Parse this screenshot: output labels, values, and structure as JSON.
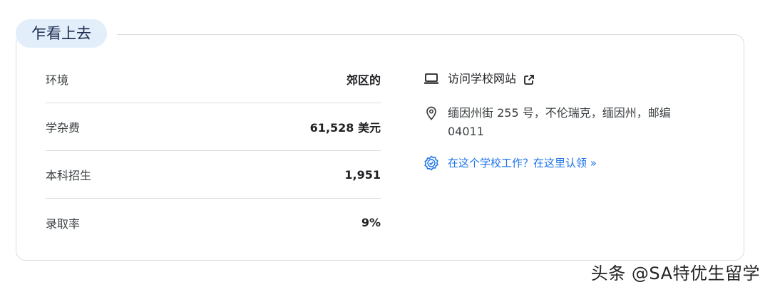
{
  "header": {
    "title": "乍看上去"
  },
  "stats": [
    {
      "label": "环境",
      "value": "郊区的"
    },
    {
      "label": "学杂费",
      "value": "61,528 美元"
    },
    {
      "label": "本科招生",
      "value": "1,951"
    },
    {
      "label": "录取率",
      "value": "9%"
    }
  ],
  "info": {
    "website_label": "访问学校网站",
    "address": "缅因州街 255 号，不伦瑞克，缅因州，邮编 04011",
    "claim_link": "在这个学校工作？在这里认领 »"
  },
  "icons": [
    "laptop-icon",
    "external-link-icon",
    "location-pin-icon",
    "verified-badge-icon"
  ],
  "colors": {
    "accent": "#1a73e8",
    "pill_bg": "#e3eefb",
    "border": "#dadce0"
  },
  "watermark": "头条 @SA特优生留学"
}
